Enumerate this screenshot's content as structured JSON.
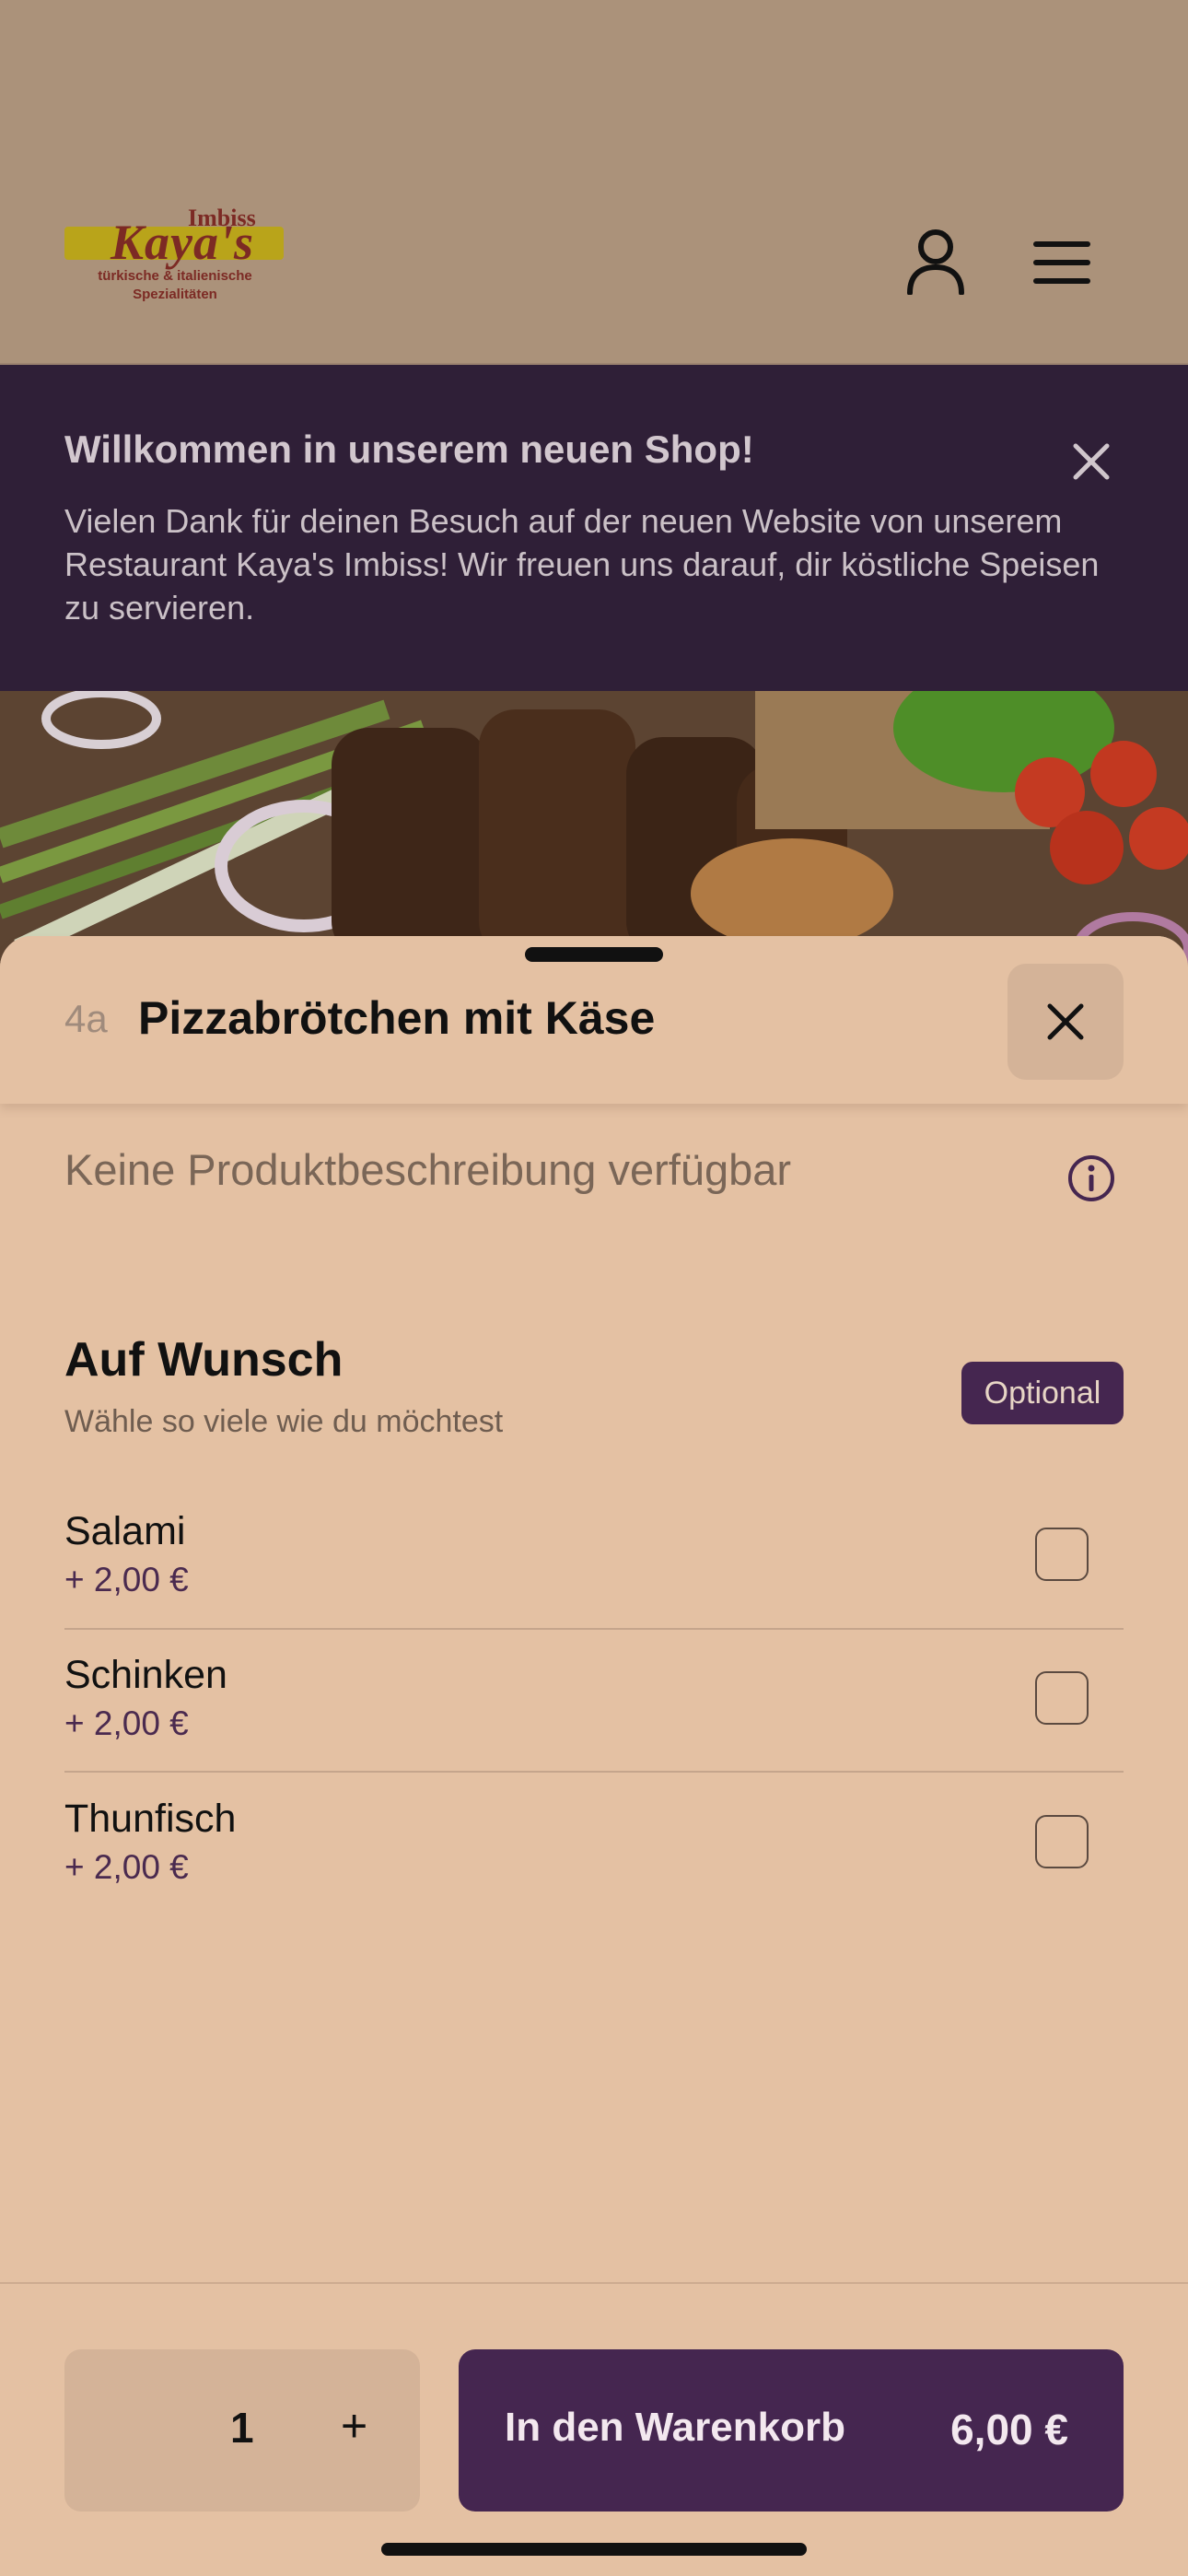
{
  "header": {
    "logo": {
      "brand": "Kaya's",
      "tag": "Imbiss",
      "subtitle_line1": "türkische & italienische",
      "subtitle_line2": "Spezialitäten"
    },
    "icons": [
      "user-icon",
      "menu-icon"
    ]
  },
  "banner": {
    "title": "Willkommen in unserem neuen Shop!",
    "text": "Vielen Dank für deinen Besuch auf der neuen Website von unserem Restaurant Kaya's Imbiss! Wir freuen uns darauf, dir köstliche Speisen zu servieren."
  },
  "product": {
    "number": "4a",
    "title": "Pizzabrötchen mit Käse",
    "description": "Keine Produktbeschreibung verfügbar"
  },
  "option_group": {
    "title": "Auf Wunsch",
    "subtitle": "Wähle so viele wie du möchtest",
    "badge": "Optional",
    "items": [
      {
        "name": "Salami",
        "price": "+ 2,00 €",
        "checked": false
      },
      {
        "name": "Schinken",
        "price": "+ 2,00 €",
        "checked": false
      },
      {
        "name": "Thunfisch",
        "price": "+ 2,00 €",
        "checked": false
      }
    ]
  },
  "footer": {
    "quantity": "1",
    "plus": "+",
    "add_to_cart_label": "In den Warenkorb",
    "total": "6,00 €"
  },
  "colors": {
    "accent": "#452650",
    "sheet_bg": "#e4c1a3",
    "banner_bg": "#2f1f37",
    "secondary_button_bg": "#d4b398"
  }
}
